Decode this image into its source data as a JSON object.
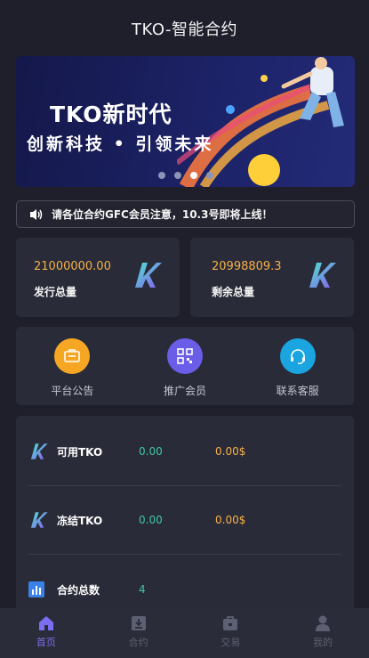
{
  "header": {
    "title": "TKO-智能合约"
  },
  "banner": {
    "title": "TKO新时代",
    "subtitle": "创新科技 • 引领未来",
    "slides": 4,
    "active_slide": 3
  },
  "notice": {
    "text": "请各位合约GFC会员注意，10.3号即将上线！"
  },
  "stats": [
    {
      "value": "21000000.00",
      "label": "发行总量"
    },
    {
      "value": "20998809.3",
      "label": "剩余总量"
    }
  ],
  "actions": [
    {
      "label": "平台公告",
      "icon": "announcement-icon",
      "color": "#f5a623"
    },
    {
      "label": "推广会员",
      "icon": "qrcode-icon",
      "color": "#6a5ee8"
    },
    {
      "label": "联系客服",
      "icon": "headset-icon",
      "color": "#1aa5e0"
    }
  ],
  "balances": [
    {
      "name": "可用TKO",
      "amount": "0.00",
      "value": "0.00$"
    },
    {
      "name": "冻结TKO",
      "amount": "0.00",
      "value": "0.00$"
    },
    {
      "name": "合约总数",
      "amount": "4"
    }
  ],
  "tabbar": [
    {
      "label": "首页",
      "icon": "home-icon",
      "active": true
    },
    {
      "label": "合约",
      "icon": "contract-icon",
      "active": false
    },
    {
      "label": "交易",
      "icon": "trade-icon",
      "active": false
    },
    {
      "label": "我的",
      "icon": "user-icon",
      "active": false
    }
  ],
  "colors": {
    "background": "#1e1f2b",
    "card": "#2a2b38",
    "accent_gold": "#f5b04a",
    "accent_green": "#3fc7a3",
    "active_tab": "#7b6ef0"
  }
}
